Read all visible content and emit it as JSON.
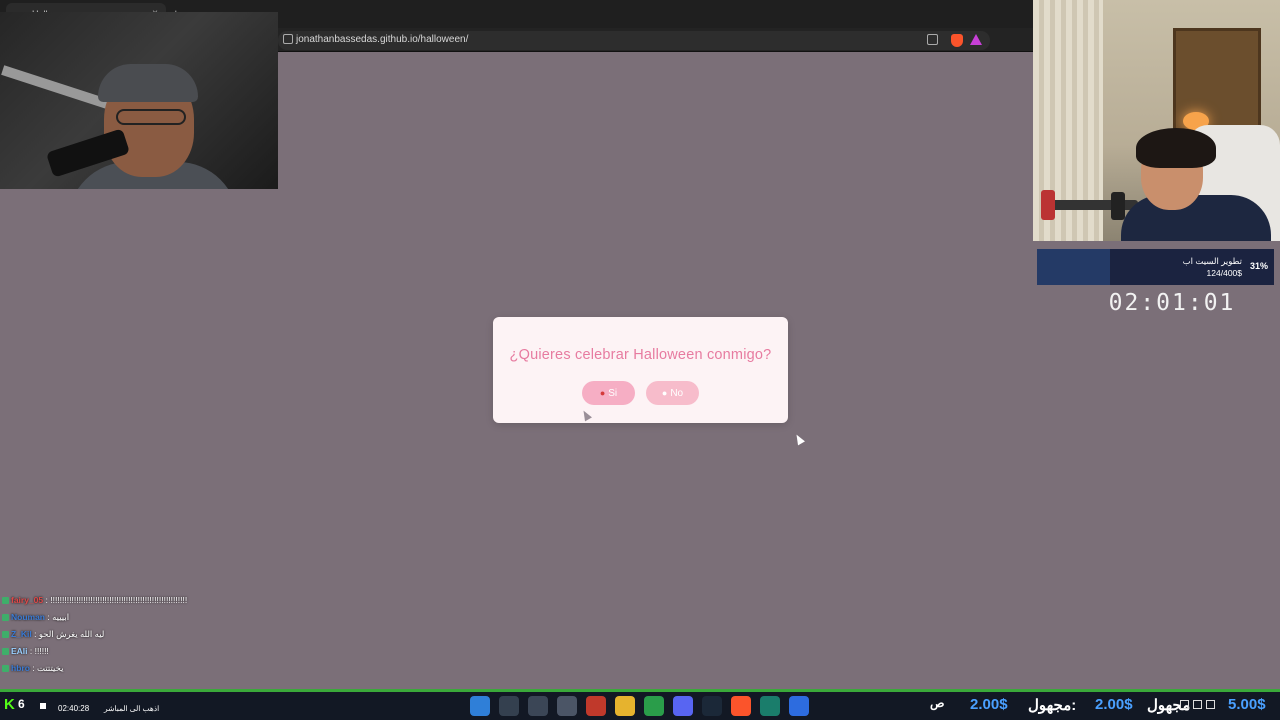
{
  "browser": {
    "tab_title": "Halloween",
    "tab_close": "×",
    "new_tab": "+",
    "url": "jonathanbassedas.github.io/halloween/"
  },
  "modal": {
    "question": "¿Quieres celebrar Halloween conmigo?",
    "yes_label": "Si",
    "no_label": "No",
    "yes_icon": "pumpkin-icon",
    "no_icon": "ghost-icon"
  },
  "goal": {
    "title": "تطوير السيت اب",
    "amount": "124/400$",
    "percent_label": "31%",
    "progress": 0.31
  },
  "timer": "02:01:01",
  "chat": [
    {
      "name": "fairy_05",
      "message": "!!!!!!!!!!!!!!!!!!!!!!!!!!!!!!!!!!!!!!!!!!!!!!!!!!!!!!!!!!",
      "color": "#e04848"
    },
    {
      "name": "Nouman",
      "message": "ابيييه",
      "color": "#3a7bd5"
    },
    {
      "name": "Z_Kil",
      "message": "ليه الله يغرش الحو",
      "color": "#3a7bd5"
    },
    {
      "name": "EAli",
      "message": "!!!!!!",
      "color": "#9ad0ff"
    },
    {
      "name": "hbro",
      "message": "يخيتتتت",
      "color": "#3a7bd5"
    }
  ],
  "taskbar": {
    "viewer_count": "6",
    "uptime": "02:40:28",
    "live_label": "اذهب الى المباشر",
    "tray_amount_1": "2.00$",
    "tray_label_1": "مجهول:",
    "tray_amount_2": "2.00$",
    "tray_label_2": "مجهول",
    "tray_amount_3": "5.00$",
    "tray_left_glyph": "ص"
  }
}
